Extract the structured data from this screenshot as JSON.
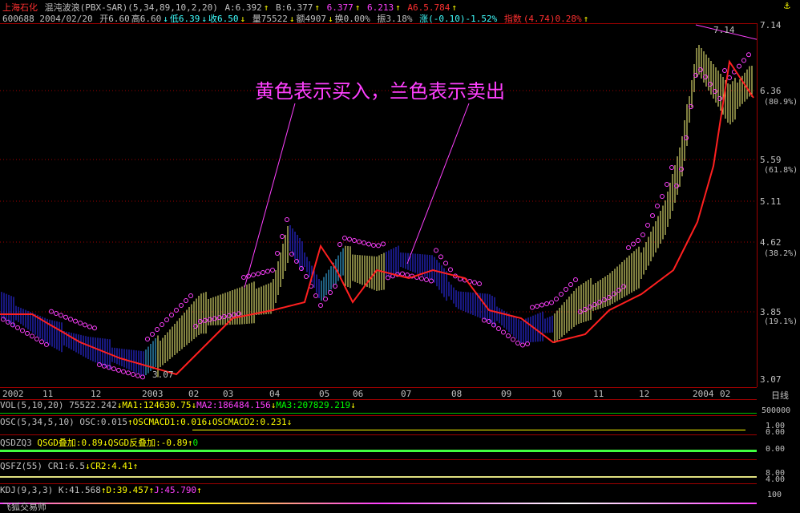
{
  "header": {
    "stock_name": "上海石化",
    "indicator": "混沌波浪(PBX-SAR)(5,34,89,10,2,20)",
    "a": "A:6.392",
    "b": "B:6.377",
    "v3": "6.377",
    "v4": "6.213",
    "a6": "A6.5.784",
    "up_arrow": "↑",
    "down_arrow": "↓",
    "top_right_icon": "anchor-icon"
  },
  "info": {
    "code_date": "600688 2004/02/20",
    "open": "开6.60",
    "high": "高6.60",
    "low": "低6.39",
    "close": "收6.50",
    "volume": "量75522",
    "amount": "额4907",
    "turnover": "换0.00%",
    "amplitude": "振3.18%",
    "change": "涨(-0.10)-1.52%",
    "index_label": "指数",
    "index_value": "(4.74)0.28%"
  },
  "annotation": {
    "text": "黄色表示买入，兰色表示卖出",
    "label_714": "7.14",
    "label_307": "3.07",
    "color": "#ff40ff"
  },
  "price_axis": {
    "ticks": [
      "7.14",
      "6.36",
      "5.59",
      "5.11",
      "4.62",
      "3.85",
      "3.07"
    ],
    "pcts": [
      "(80.9%)",
      "(61.8%)",
      "(38.2%)",
      "(19.1%)"
    ]
  },
  "time_axis": {
    "labels": [
      "2002",
      "11",
      "12",
      "2003",
      "02",
      "03",
      "04",
      "05",
      "06",
      "07",
      "08",
      "09",
      "10",
      "11",
      "12",
      "2004",
      "02"
    ],
    "period_label": "日线"
  },
  "panels": {
    "vol": {
      "label": "VOL(5,10,20)",
      "v1": "75522.242",
      "ma1": "MA1:124630.75",
      "ma2": "MA2:186484.156",
      "ma3": "MA3:207829.219",
      "axis": "500000"
    },
    "osc": {
      "label": "OSC(5,34,5,10)",
      "osc": "OSC:0.015",
      "m1": "OSCMACD1:0.016",
      "m2": "OSCMACD2:0.231",
      "axis1": "1.00",
      "axis2": "0.00"
    },
    "qsd": {
      "label": "QSDZQ3",
      "a": "QSGD叠加:0.89",
      "b": "QSGD反叠加:-0.89",
      "zero": "0",
      "axis": "0.00"
    },
    "qsfz": {
      "label": "QSFZ(55)",
      "cr1": "CR1:6.5",
      "cr2": "CR2:4.41",
      "axis1": "8.00",
      "axis2": "4.00"
    },
    "kdj": {
      "label": "KDJ(9,3,3)",
      "k": "K:41.568",
      "d": "D:39.457",
      "j": "J:45.790",
      "axis": "100"
    }
  },
  "footer": {
    "brand": "飞狐交易师"
  },
  "colors": {
    "up": "#ff3030",
    "down": "#00ff00",
    "yellow_bar": "#ffff80",
    "blue_bar": "#4040ff",
    "ma": "#ff2020",
    "sar": "#ff40ff",
    "grid": "#a00000"
  }
}
